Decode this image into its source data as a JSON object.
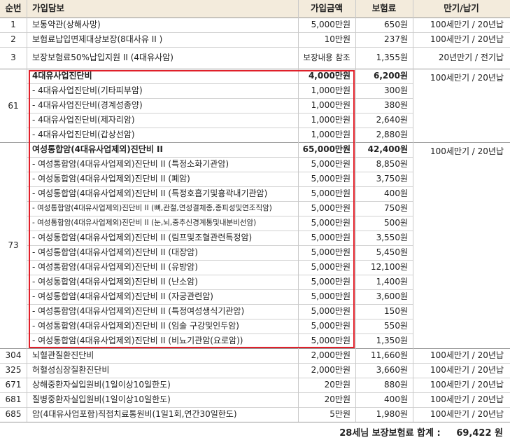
{
  "header": {
    "no": "순번",
    "coverage": "가입담보",
    "amount": "가입금액",
    "premium": "보험료",
    "term": "만기/납기"
  },
  "rows": [
    {
      "no": "1",
      "coverage": "보통약관(상해사망)",
      "amount": "5,000만원",
      "premium": "650원",
      "term": "100세만기 / 20년납"
    },
    {
      "no": "2",
      "coverage": "보험료납입면제대상보장(8대사유 II )",
      "amount": "10만원",
      "premium": "237원",
      "term": "100세만기 / 20년납"
    },
    {
      "no": "3",
      "coverage": "보장보험료50%납입지원 II (4대유사암)",
      "amount": "보장내용 참조",
      "premium": "1,355원",
      "term": "20년만기 / 전기납"
    }
  ],
  "group61": {
    "no": "61",
    "term": "100세만기 / 20년납",
    "rows": [
      {
        "coverage": "4대유사업진단비",
        "amount": "4,000만원",
        "premium": "6,200원",
        "bold": true
      },
      {
        "coverage": "- 4대유사업진단비(기타피부암)",
        "amount": "1,000만원",
        "premium": "300원"
      },
      {
        "coverage": "- 4대유사업진단비(경계성종양)",
        "amount": "1,000만원",
        "premium": "380원"
      },
      {
        "coverage": "- 4대유사업진단비(제자리암)",
        "amount": "1,000만원",
        "premium": "2,640원"
      },
      {
        "coverage": "- 4대유사업진단비(갑상선암)",
        "amount": "1,000만원",
        "premium": "2,880원"
      }
    ]
  },
  "group73": {
    "no": "73",
    "term": "100세만기 / 20년납",
    "rows": [
      {
        "coverage": "여성통합암(4대유사업제외)진단비 II",
        "amount": "65,000만원",
        "premium": "42,400원",
        "bold": true
      },
      {
        "coverage": "- 여성통합암(4대유사업제외)진단비 II (특정소화기관암)",
        "amount": "5,000만원",
        "premium": "8,850원"
      },
      {
        "coverage": "- 여성통합암(4대유사업제외)진단비 II (폐암)",
        "amount": "5,000만원",
        "premium": "3,750원"
      },
      {
        "coverage": "- 여성통합암(4대유사업제외)진단비 II (특정호흡기및흉곽내기관암)",
        "amount": "5,000만원",
        "premium": "400원"
      },
      {
        "coverage": "- 여성통합암(4대유사업제외)진단비 II (뼈,관절,연성결체종,종피성및연조직암)",
        "amount": "5,000만원",
        "premium": "750원"
      },
      {
        "coverage": "- 여성통합암(4대유사업제외)진단비 II (눈,뇌,중추신경계통및내분비선암)",
        "amount": "5,000만원",
        "premium": "500원"
      },
      {
        "coverage": "- 여성통합암(4대유사업제외)진단비 II (림프및조혈관련특정암)",
        "amount": "5,000만원",
        "premium": "3,550원"
      },
      {
        "coverage": "- 여성통합암(4대유사업제외)진단비 II (대장암)",
        "amount": "5,000만원",
        "premium": "5,450원"
      },
      {
        "coverage": "- 여성통합암(4대유사업제외)진단비 II (유방암)",
        "amount": "5,000만원",
        "premium": "12,100원"
      },
      {
        "coverage": "- 여성통합암(4대유사업제외)진단비 II (난소암)",
        "amount": "5,000만원",
        "premium": "1,400원"
      },
      {
        "coverage": "- 여성통합암(4대유사업제외)진단비 II (자궁관련암)",
        "amount": "5,000만원",
        "premium": "3,600원"
      },
      {
        "coverage": "- 여성통합암(4대유사업제외)진단비 II (특정여성생식기관암)",
        "amount": "5,000만원",
        "premium": "150원"
      },
      {
        "coverage": "- 여성통합암(4대유사업제외)진단비 II (임술 구강및인두암)",
        "amount": "5,000만원",
        "premium": "550원"
      },
      {
        "coverage": "- 여성통합암(4대유사업제외)진단비 II (비뇨기관암(요로암))",
        "amount": "5,000만원",
        "premium": "1,350원"
      }
    ]
  },
  "rows_after": [
    {
      "no": "304",
      "coverage": "뇌혈관질환진단비",
      "amount": "2,000만원",
      "premium": "11,660원",
      "term": "100세만기 / 20년납"
    },
    {
      "no": "325",
      "coverage": "허혈성심장질환진단비",
      "amount": "2,000만원",
      "premium": "3,660원",
      "term": "100세만기 / 20년납"
    },
    {
      "no": "671",
      "coverage": "상해중환자실입원비(1일이상10일한도)",
      "amount": "20만원",
      "premium": "880원",
      "term": "100세만기 / 20년납"
    },
    {
      "no": "681",
      "coverage": "질병중환자실입원비(1일이상10일한도)",
      "amount": "20만원",
      "premium": "400원",
      "term": "100세만기 / 20년납"
    },
    {
      "no": "685",
      "coverage": "암(4대유사업포함)직접치료통원비(1일1회,연간30일한도)",
      "amount": "5만원",
      "premium": "1,980원",
      "term": "100세만기 / 20년납"
    }
  ],
  "total": {
    "label": "28세님 보장보험료 합계 :",
    "value": "69,422 원"
  },
  "colors": {
    "header_bg": "#f3ebdc",
    "highlight_border": "#e0202a"
  }
}
